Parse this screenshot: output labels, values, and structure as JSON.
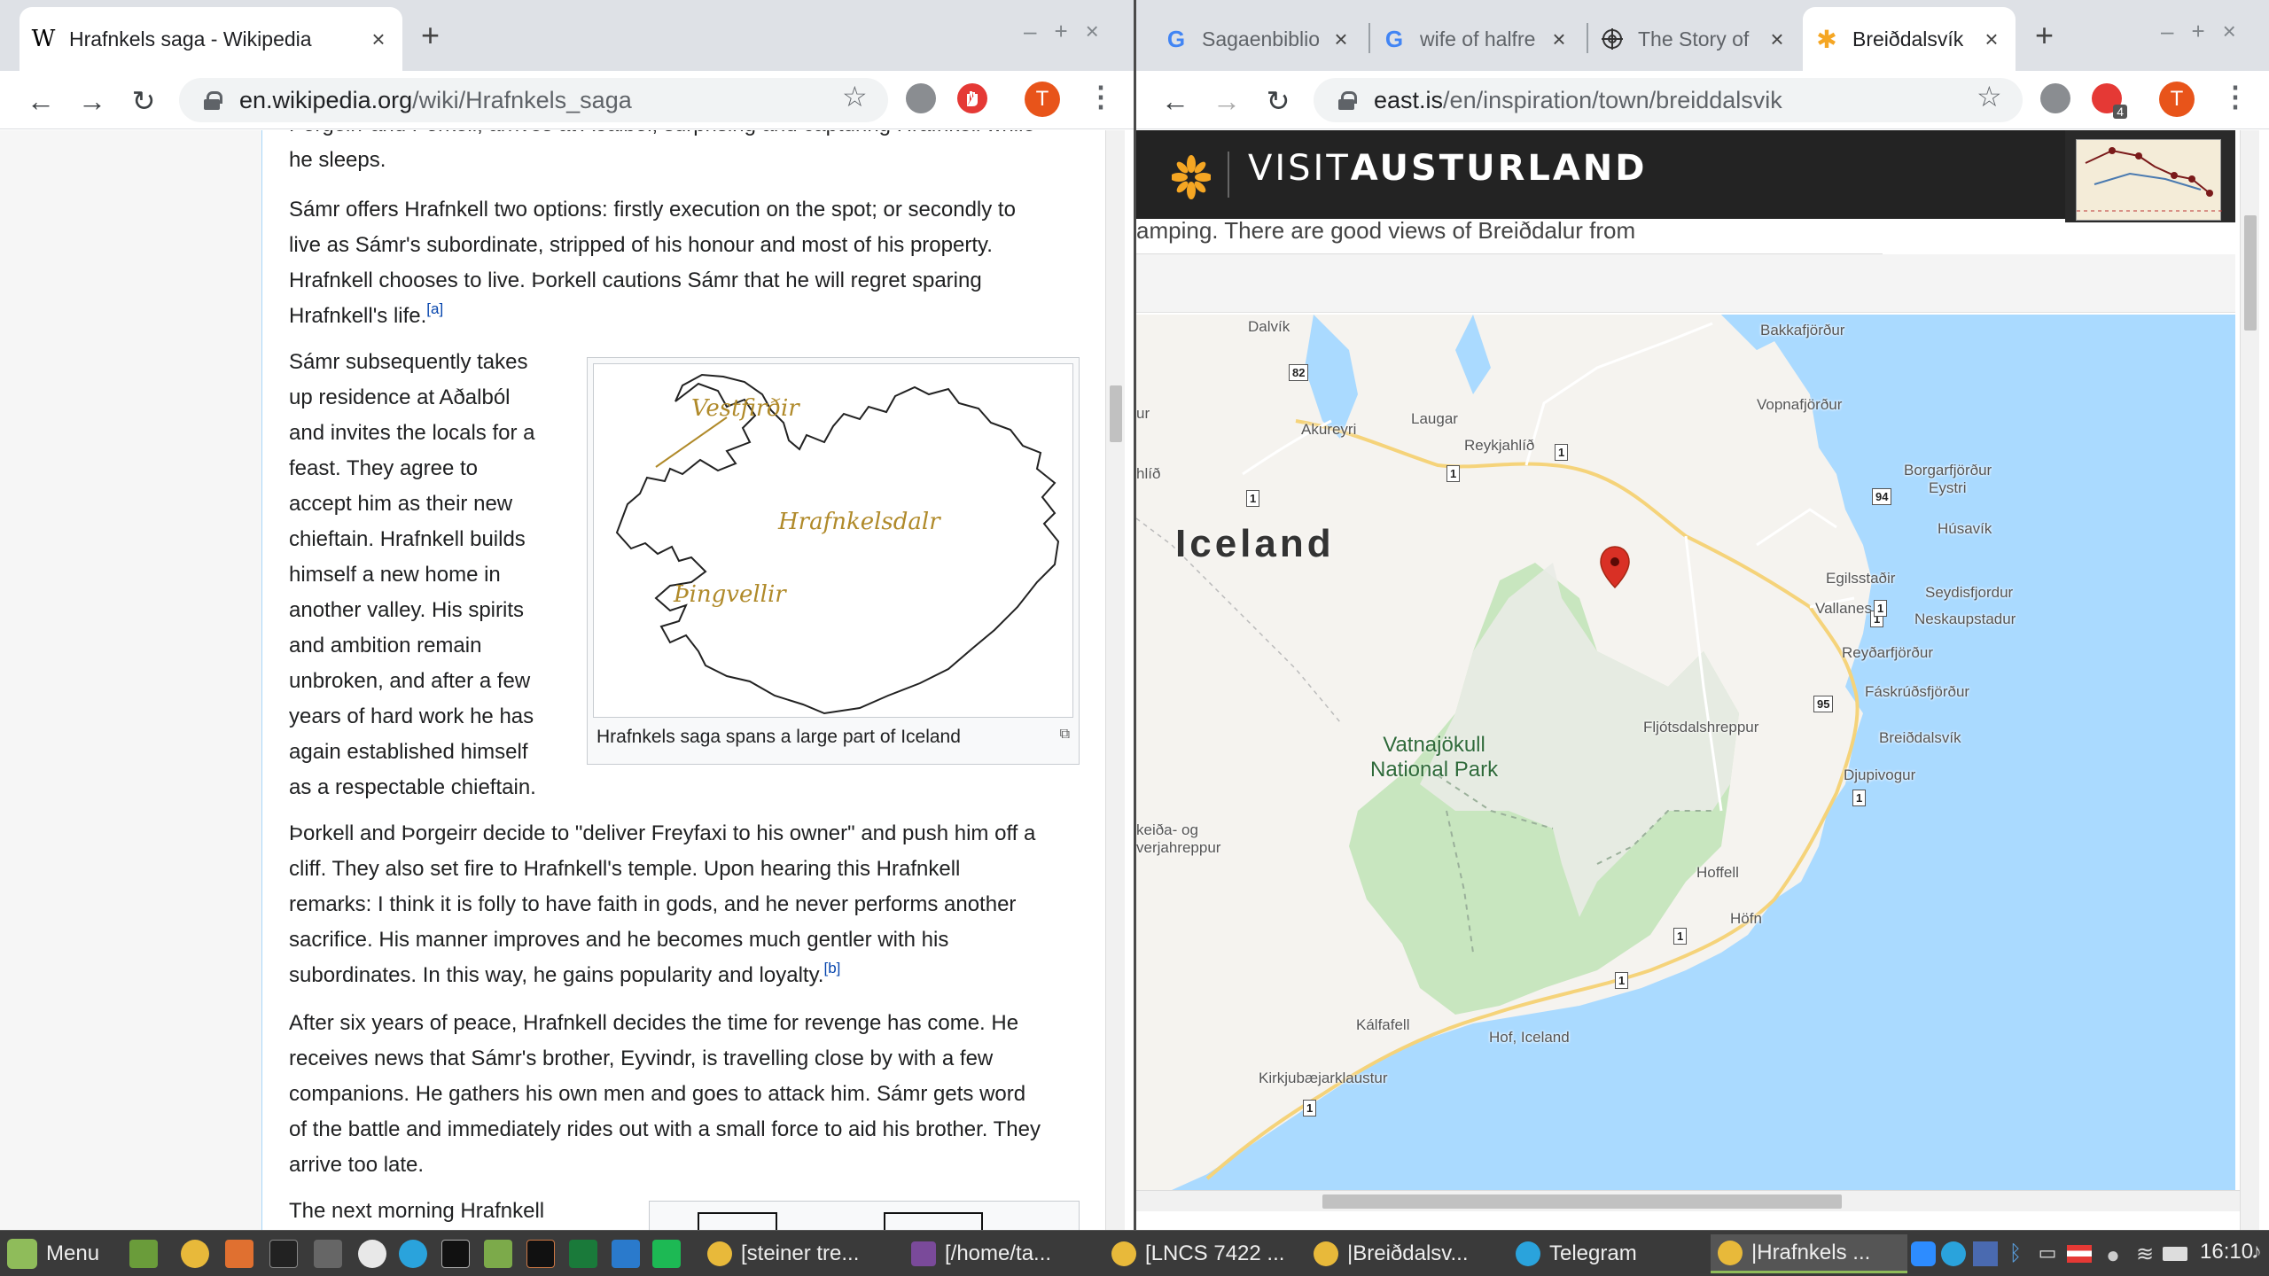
{
  "left_window": {
    "tabs": [
      {
        "title": "Hrafnkels saga - Wikipedia",
        "favicon": "wikipedia-W",
        "active": true
      }
    ],
    "new_tab": "+",
    "window_controls": [
      "–",
      "+",
      "×"
    ],
    "url": {
      "domain": "en.wikipedia.org",
      "path": "/wiki/Hrafnkels_saga"
    },
    "avatar_letter": "T",
    "article": {
      "cut_line": "Þorgeirr and Þorkell, arrives at Aðalból, surprising and capturing Hrafnkell while",
      "cut_line2": "he sleeps.",
      "p1": [
        "Sámr offers Hrafnkell two options: firstly execution on the spot; or secondly to",
        "live as Sámr's subordinate, stripped of his honour and most of his property.",
        "Hrafnkell chooses to live. Þorkell cautions Sámr that he will regret sparing",
        "Hrafnkell's life."
      ],
      "p1_note": "[a]",
      "p2": [
        "Sámr subsequently takes",
        "up residence at Aðalból",
        "and invites the locals for a",
        "feast. They agree to",
        "accept him as their new",
        "chieftain. Hrafnkell builds",
        "himself a new home in",
        "another valley. His spirits",
        "and ambition remain",
        "unbroken, and after a few",
        "years of hard work he has",
        "again established himself",
        "as a respectable chieftain."
      ],
      "p3": [
        "Þorkell and Þorgeirr decide to \"deliver Freyfaxi to his owner\" and push him off a",
        "cliff. They also set fire to Hrafnkell's temple. Upon hearing this Hrafnkell",
        "remarks: I think it is folly to have faith in gods, and he never performs another",
        "sacrifice. His manner improves and he becomes much gentler with his",
        "subordinates. In this way, he gains popularity and loyalty."
      ],
      "p3_note": "[b]",
      "p4": [
        "After six years of peace, Hrafnkell decides the time for revenge has come. He",
        "receives news that Sámr's brother, Eyvindr, is travelling close by with a few",
        "companions. He gathers his own men and goes to attack him. Sámr gets word",
        "of the battle and immediately rides out with a small force to aid his brother. They",
        "arrive too late."
      ],
      "p5": "The next morning Hrafnkell",
      "figure": {
        "labels": [
          "Vestfirðir",
          "Hrafnkelsdalr",
          "Þingvellir"
        ],
        "caption": "Hrafnkels saga spans a large part of Iceland"
      }
    }
  },
  "right_window": {
    "tabs": [
      {
        "title": "Sagaenbiblio",
        "favicon": "google-G"
      },
      {
        "title": "wife of halfre",
        "favicon": "google-G"
      },
      {
        "title": "The Story of",
        "favicon": "target"
      },
      {
        "title": "Breiðdalsvík",
        "favicon": "visitausturland-star",
        "active": true
      }
    ],
    "new_tab": "+",
    "window_controls": [
      "–",
      "+",
      "×"
    ],
    "url": {
      "domain": "east.is",
      "path": "/en/inspiration/town/breiddalsvik"
    },
    "ext_badge": "4",
    "avatar_letter": "T",
    "site": {
      "brand_light": "VISIT",
      "brand_bold": "AUSTURLAND",
      "text_strip": "amping. There are good views of Breiðdalur from"
    },
    "map": {
      "country_label": "Iceland",
      "park_label": [
        "Vatnajökull",
        "National Park"
      ],
      "places": [
        "Dalvík",
        "Akureyri",
        "Laugar",
        "Reykjahlíð",
        "Bakkafjörður",
        "Vopnafjörður",
        "Borgarfjörður",
        "Eystri",
        "Húsavík",
        "Egilsstaðir",
        "Seydisfjordur",
        "Vallanes",
        "Neskaupstadur",
        "Reyðarfjörður",
        "Fáskrúðsfjörður",
        "Breiðdalsvík",
        "Djupivogur",
        "Fljótsdalshreppur",
        "Hoffell",
        "Höfn",
        "Kálfafell",
        "Hof, Iceland",
        "Kirkjubæjarklaustur",
        "ur",
        "hlíð",
        "keiða- og",
        "verjahreppur"
      ],
      "roads": [
        "82",
        "1",
        "1",
        "1",
        "1",
        "94",
        "1",
        "95",
        "1",
        "1",
        "1",
        "1"
      ]
    }
  },
  "taskbar": {
    "menu_label": "Menu",
    "windows": [
      {
        "title": "[steiner tre...",
        "active": false
      },
      {
        "title": "[/home/ta...",
        "active": false
      },
      {
        "title": "[LNCS 7422 ...",
        "active": false
      },
      {
        "title": "|Breiðdalsv...",
        "active": false
      },
      {
        "title": "Telegram",
        "active": false
      },
      {
        "title": "|Hrafnkels ...",
        "active": true
      }
    ],
    "clock": "16:10"
  },
  "colors": {
    "map_water": "#aadaff",
    "map_land": "#f5f3ef",
    "park_green": "#c8e6bf",
    "pin_red": "#d93025",
    "avatar_orange": "#e8541a",
    "visit_star": "#f5a623"
  }
}
